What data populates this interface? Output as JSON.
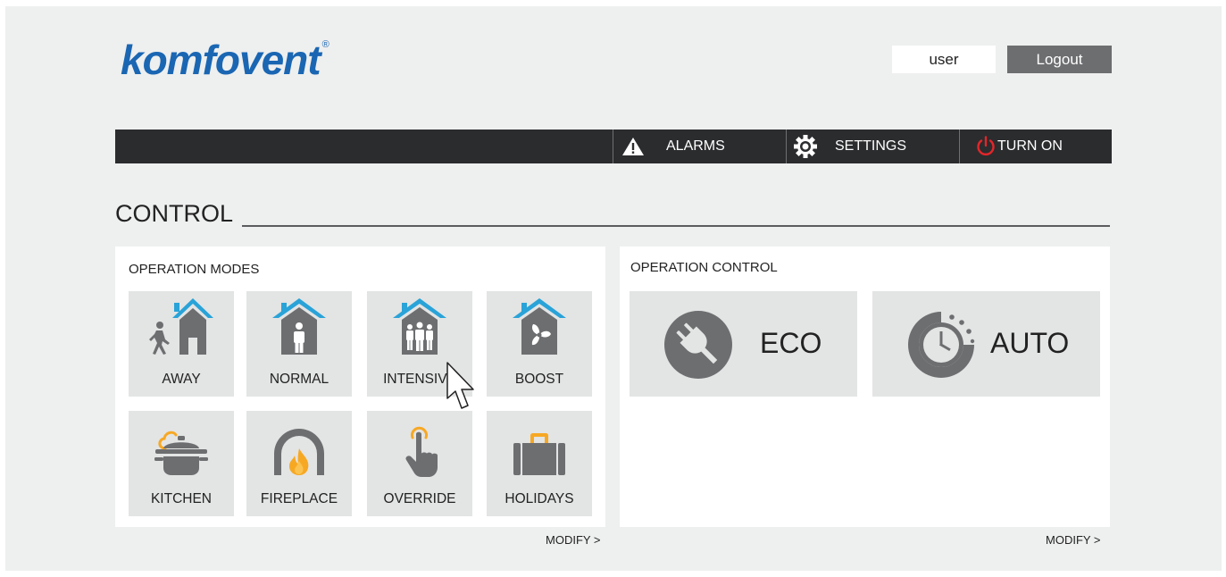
{
  "header": {
    "logo": "komfovent",
    "logo_mark": "®",
    "user": "user",
    "logout_label": "Logout"
  },
  "nav": {
    "alarms_label": "ALARMS",
    "settings_label": "SETTINGS",
    "turn_on_label": "TURN ON",
    "icons": [
      "warning-icon",
      "gear-icon",
      "power-icon"
    ],
    "power_icon_color": "#e3262a"
  },
  "section": {
    "title": "CONTROL"
  },
  "operation_modes": {
    "title": "OPERATION MODES",
    "modes": [
      {
        "label": "AWAY",
        "icon": "away-house-icon"
      },
      {
        "label": "NORMAL",
        "icon": "normal-house-icon"
      },
      {
        "label": "INTENSIVE",
        "icon": "intensive-house-icon"
      },
      {
        "label": "BOOST",
        "icon": "boost-fan-house-icon"
      },
      {
        "label": "KITCHEN",
        "icon": "kitchen-pot-icon"
      },
      {
        "label": "FIREPLACE",
        "icon": "fireplace-icon"
      },
      {
        "label": "OVERRIDE",
        "icon": "override-hand-icon"
      },
      {
        "label": "HOLIDAYS",
        "icon": "holidays-suitcase-icon"
      }
    ],
    "modify_label": "MODIFY >"
  },
  "operation_control": {
    "title": "OPERATION CONTROL",
    "items": [
      {
        "label": "ECO",
        "icon": "eco-plug-icon"
      },
      {
        "label": "AUTO",
        "icon": "auto-clock-icon"
      }
    ],
    "modify_label": "MODIFY >"
  },
  "colors": {
    "brand_blue": "#1a66b3",
    "roof_blue": "#29a3d8",
    "accent_orange": "#f7a823",
    "icon_gray": "#6d6e70",
    "navbar": "#2b2c2e"
  }
}
